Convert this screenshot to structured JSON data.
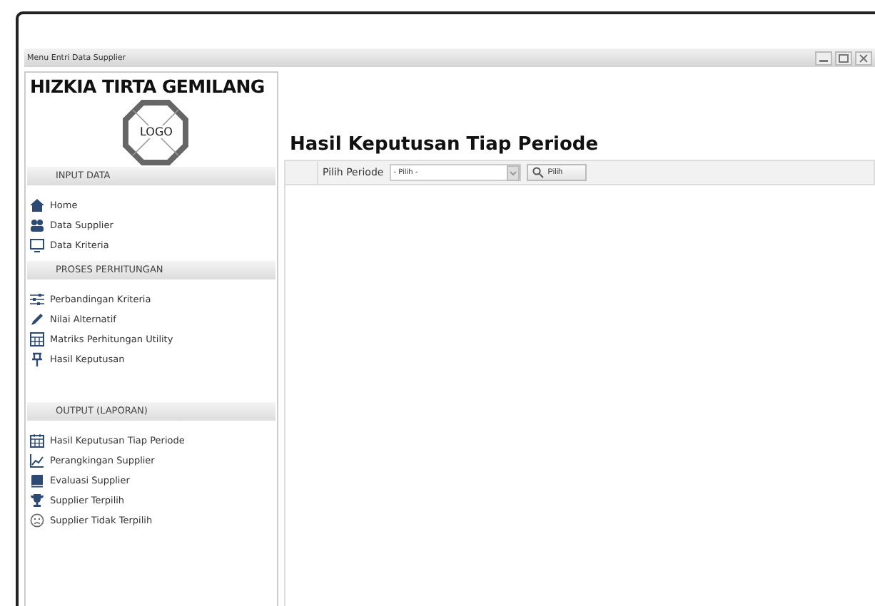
{
  "window": {
    "title": "Menu Entri Data Supplier"
  },
  "sidebar": {
    "company": "HIZKIA TIRTA GEMILANG",
    "logo": "LOGO",
    "sections": [
      {
        "title": "INPUT DATA",
        "items": [
          "Home",
          "Data Supplier",
          "Data Kriteria"
        ]
      },
      {
        "title": "PROSES PERHITUNGAN",
        "items": [
          "Perbandingan Kriteria",
          "Nilai Alternatif",
          "Matriks Perhitungan Utility",
          "Hasil Keputusan"
        ]
      },
      {
        "title": "OUTPUT (LAPORAN)",
        "items": [
          "Hasil Keputusan Tiap Periode",
          "Perangkingan Supplier",
          "Evaluasi Supplier",
          "Supplier Terpilih",
          "Supplier Tidak Terpilih"
        ]
      }
    ]
  },
  "main": {
    "heading": "Hasil Keputusan Tiap Periode",
    "period_label": "Pilih Periode",
    "period_select": "- Pilih -",
    "pick_button": "Pilih"
  }
}
